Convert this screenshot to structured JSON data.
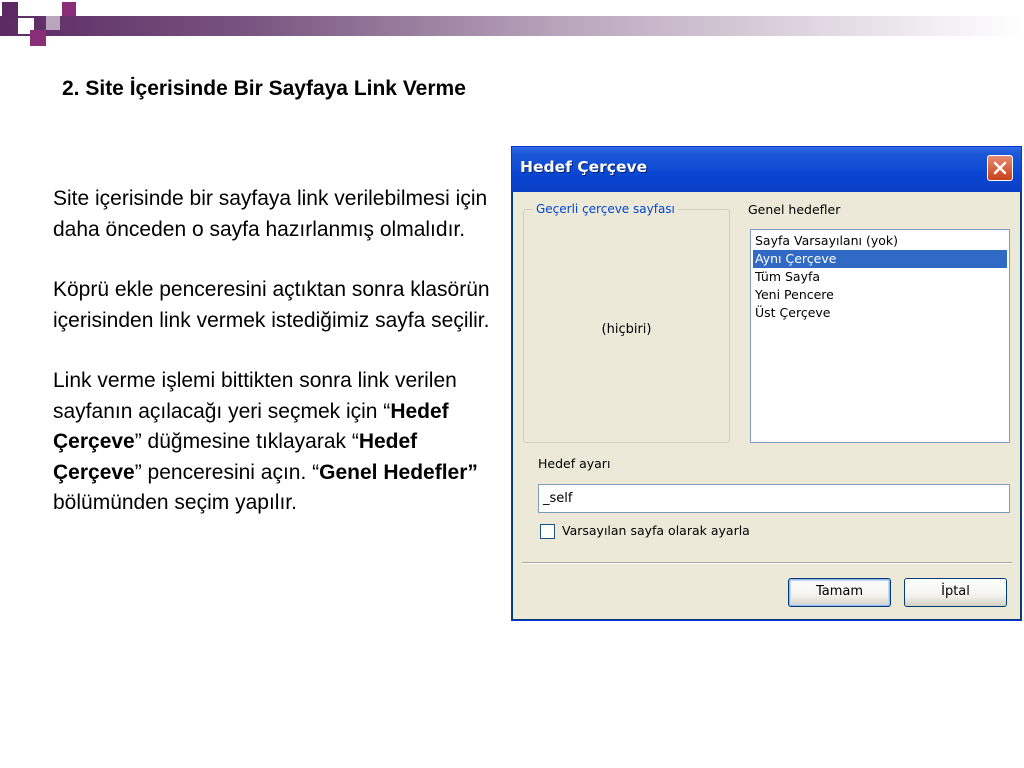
{
  "slide": {
    "title": "2. Site İçerisinde Bir Sayfaya Link Verme",
    "para1": "Site içerisinde bir sayfaya link verilebilmesi için daha önceden o sayfa hazırlanmış olmalıdır.",
    "para2": "Köprü ekle penceresini açtıktan sonra klasörün içerisinden link vermek istediğimiz sayfa seçilir.",
    "para3": {
      "t1": "Link verme işlemi bittikten sonra link verilen sayfanın açılacağı yeri seçmek için “",
      "b1": "Hedef Çerçeve",
      "t2": "” düğmesine tıklayarak “",
      "b2": "Hedef Çerçeve",
      "t3": "” penceresini açın. “",
      "b3": "Genel Hedefler”",
      "t4": " bölümünden seçim yapılır."
    }
  },
  "dialog": {
    "title": "Hedef Çerçeve",
    "current_frame_label": "Geçerli çerçeve sayfası",
    "current_frame_value": "(hiçbiri)",
    "common_targets_label": "Genel hedefler",
    "common_targets": [
      "Sayfa Varsayılanı (yok)",
      "Aynı Çerçeve",
      "Tüm Sayfa",
      "Yeni Pencere",
      "Üst Çerçeve"
    ],
    "selected_index": 1,
    "target_setting_label": "Hedef ayarı",
    "target_setting_value": "_self",
    "default_checkbox_label": "Varsayılan sayfa olarak ayarla",
    "ok_label": "Tamam",
    "cancel_label": "İptal"
  },
  "colors": {
    "title_bar": "#0a46d2",
    "selection": "#316ac5",
    "dialog_bg": "#ece9d8",
    "accent_purple": "#5b2a63"
  }
}
